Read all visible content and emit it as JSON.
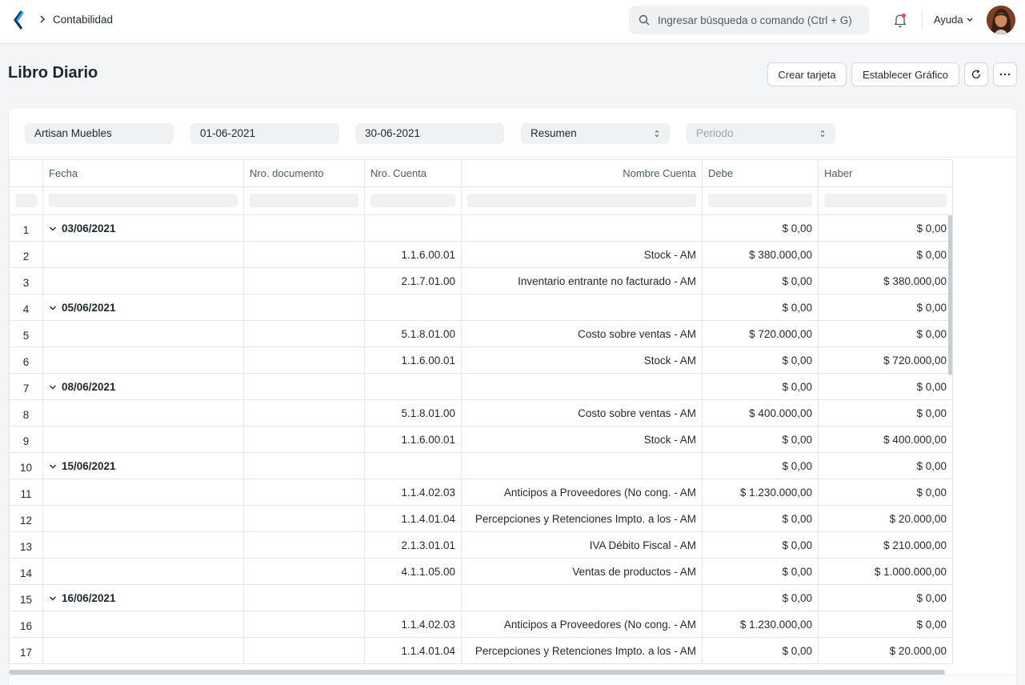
{
  "navbar": {
    "breadcrumb": "Contabilidad",
    "search_placeholder": "Ingresar búsqueda o comando (Ctrl + G)",
    "help_label": "Ayuda"
  },
  "page": {
    "title": "Libro Diario",
    "create_card_label": "Crear tarjeta",
    "set_chart_label": "Establecer Gráfico"
  },
  "filters": {
    "company": "Artisan Muebles",
    "from_date": "01-06-2021",
    "to_date": "30-06-2021",
    "group_by": "Resumen",
    "period_placeholder": "Periodo"
  },
  "table": {
    "columns": [
      "Fecha",
      "Nro. documento",
      "Nro. Cuenta",
      "Nombre Cuenta",
      "Debe",
      "Haber"
    ],
    "rows": [
      {
        "n": "1",
        "group": true,
        "fecha": "03/06/2021",
        "doc": "",
        "cuenta": "",
        "nombre": "",
        "debe": "$ 0,00",
        "haber": "$ 0,00"
      },
      {
        "n": "2",
        "group": false,
        "fecha": "",
        "doc": "",
        "cuenta": "1.1.6.00.01",
        "nombre": "Stock - AM",
        "debe": "$ 380.000,00",
        "haber": "$ 0,00"
      },
      {
        "n": "3",
        "group": false,
        "fecha": "",
        "doc": "",
        "cuenta": "2.1.7.01.00",
        "nombre": "Inventario entrante no facturado - AM",
        "debe": "$ 0,00",
        "haber": "$ 380.000,00"
      },
      {
        "n": "4",
        "group": true,
        "fecha": "05/06/2021",
        "doc": "",
        "cuenta": "",
        "nombre": "",
        "debe": "$ 0,00",
        "haber": "$ 0,00"
      },
      {
        "n": "5",
        "group": false,
        "fecha": "",
        "doc": "",
        "cuenta": "5.1.8.01.00",
        "nombre": "Costo sobre ventas - AM",
        "debe": "$ 720.000,00",
        "haber": "$ 0,00"
      },
      {
        "n": "6",
        "group": false,
        "fecha": "",
        "doc": "",
        "cuenta": "1.1.6.00.01",
        "nombre": "Stock - AM",
        "debe": "$ 0,00",
        "haber": "$ 720.000,00"
      },
      {
        "n": "7",
        "group": true,
        "fecha": "08/06/2021",
        "doc": "",
        "cuenta": "",
        "nombre": "",
        "debe": "$ 0,00",
        "haber": "$ 0,00"
      },
      {
        "n": "8",
        "group": false,
        "fecha": "",
        "doc": "",
        "cuenta": "5.1.8.01.00",
        "nombre": "Costo sobre ventas - AM",
        "debe": "$ 400.000,00",
        "haber": "$ 0,00"
      },
      {
        "n": "9",
        "group": false,
        "fecha": "",
        "doc": "",
        "cuenta": "1.1.6.00.01",
        "nombre": "Stock - AM",
        "debe": "$ 0,00",
        "haber": "$ 400.000,00"
      },
      {
        "n": "10",
        "group": true,
        "fecha": "15/06/2021",
        "doc": "",
        "cuenta": "",
        "nombre": "",
        "debe": "$ 0,00",
        "haber": "$ 0,00"
      },
      {
        "n": "11",
        "group": false,
        "fecha": "",
        "doc": "",
        "cuenta": "1.1.4.02.03",
        "nombre": "Anticipos a Proveedores (No cong. - AM",
        "debe": "$ 1.230.000,00",
        "haber": "$ 0,00"
      },
      {
        "n": "12",
        "group": false,
        "fecha": "",
        "doc": "",
        "cuenta": "1.1.4.01.04",
        "nombre": "Percepciones y Retenciones Impto. a los - AM",
        "debe": "$ 0,00",
        "haber": "$ 20.000,00"
      },
      {
        "n": "13",
        "group": false,
        "fecha": "",
        "doc": "",
        "cuenta": "2.1.3.01.01",
        "nombre": "IVA Débito Fiscal - AM",
        "debe": "$ 0,00",
        "haber": "$ 210.000,00"
      },
      {
        "n": "14",
        "group": false,
        "fecha": "",
        "doc": "",
        "cuenta": "4.1.1.05.00",
        "nombre": "Ventas de productos - AM",
        "debe": "$ 0,00",
        "haber": "$ 1.000.000,00"
      },
      {
        "n": "15",
        "group": true,
        "fecha": "16/06/2021",
        "doc": "",
        "cuenta": "",
        "nombre": "",
        "debe": "$ 0,00",
        "haber": "$ 0,00"
      },
      {
        "n": "16",
        "group": false,
        "fecha": "",
        "doc": "",
        "cuenta": "1.1.4.02.03",
        "nombre": "Anticipos a Proveedores (No cong. - AM",
        "debe": "$ 1.230.000,00",
        "haber": "$ 0,00"
      },
      {
        "n": "17",
        "group": false,
        "fecha": "",
        "doc": "",
        "cuenta": "1.1.4.01.04",
        "nombre": "Percepciones y Retenciones Impto. a los - AM",
        "debe": "$ 0,00",
        "haber": "$ 20.000,00"
      }
    ]
  }
}
